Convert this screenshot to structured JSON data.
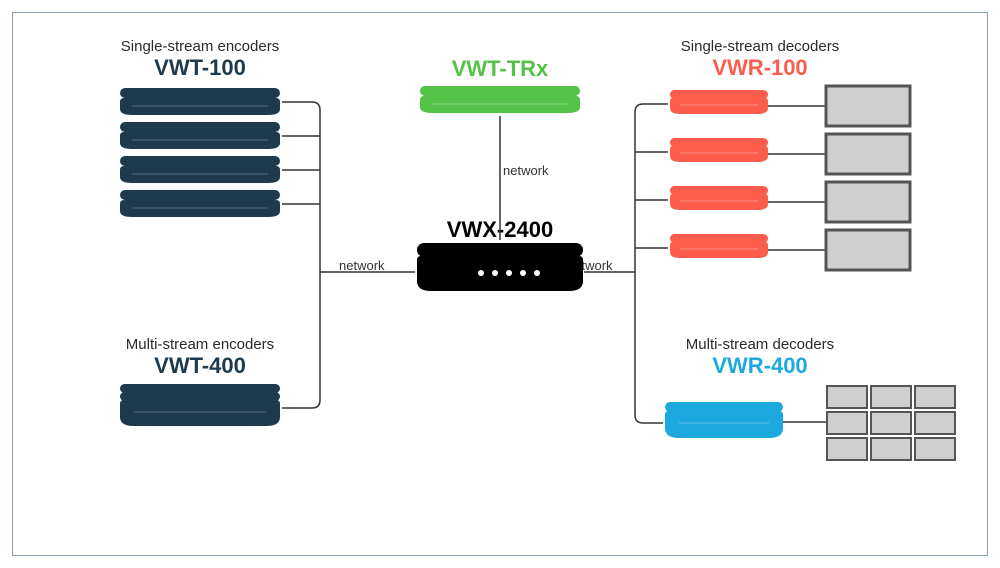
{
  "left": {
    "single": {
      "title": "Single-stream encoders",
      "model": "VWT-100"
    },
    "multi": {
      "title": "Multi-stream encoders",
      "model": "VWT-400"
    }
  },
  "top": {
    "trx": {
      "model": "VWT-TRx"
    }
  },
  "center": {
    "model": "VWX-2400"
  },
  "right": {
    "single": {
      "title": "Single-stream decoders",
      "model": "VWR-100"
    },
    "multi": {
      "title": "Multi-stream decoders",
      "model": "VWR-400"
    }
  },
  "labels": {
    "network_left": "network",
    "network_right": "network",
    "network_top": "network"
  },
  "colors": {
    "encoder": "#1e3a4f",
    "trx": "#54c247",
    "center": "#000000",
    "decoder_single": "#fc5c4c",
    "decoder_multi": "#1ca9e0",
    "screen_border": "#555",
    "screen_fill": "#cfcfcf"
  }
}
